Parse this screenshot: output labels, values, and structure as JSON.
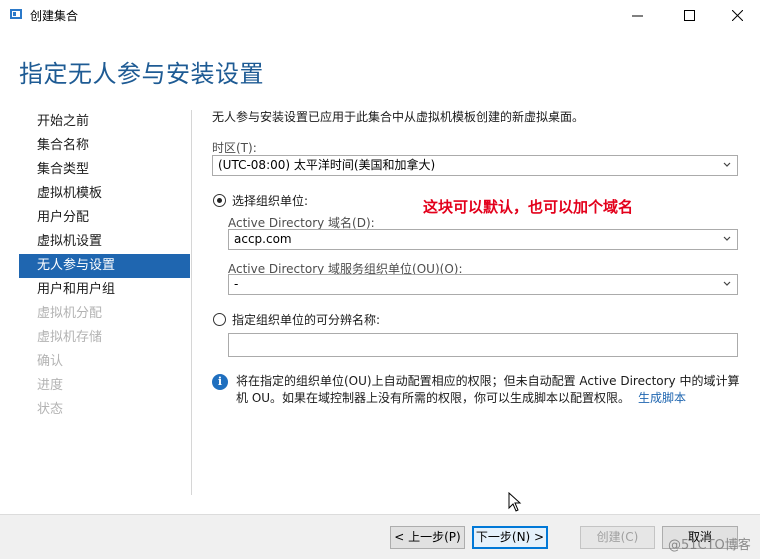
{
  "window": {
    "title": "创建集合"
  },
  "page": {
    "title": "指定无人参与安装设置",
    "description": "无人参与安装设置已应用于此集合中从虚拟机模板创建的新虚拟桌面。"
  },
  "nav": {
    "items": [
      {
        "label": "开始之前",
        "state": "normal"
      },
      {
        "label": "集合名称",
        "state": "normal"
      },
      {
        "label": "集合类型",
        "state": "normal"
      },
      {
        "label": "虚拟机模板",
        "state": "normal"
      },
      {
        "label": "用户分配",
        "state": "normal"
      },
      {
        "label": "虚拟机设置",
        "state": "normal"
      },
      {
        "label": "无人参与设置",
        "state": "active"
      },
      {
        "label": "用户和用户组",
        "state": "normal"
      },
      {
        "label": "虚拟机分配",
        "state": "disabled"
      },
      {
        "label": "虚拟机存储",
        "state": "disabled"
      },
      {
        "label": "确认",
        "state": "disabled"
      },
      {
        "label": "进度",
        "state": "disabled"
      },
      {
        "label": "状态",
        "state": "disabled"
      }
    ]
  },
  "form": {
    "timezone_label": "时区(T):",
    "timezone_value": "(UTC-08:00) 太平洋时间(美国和加拿大)",
    "radio_ou_label": "选择组织单位:",
    "ad_domain_label": "Active Directory 域名(D):",
    "ad_domain_value": "accp.com",
    "ad_ou_label": "Active Directory 域服务组织单位(OU)(O):",
    "ad_ou_value": "-",
    "radio_dn_label": "指定组织单位的可分辨名称:",
    "dn_value": ""
  },
  "annotation": "这块可以默认，也可以加个域名",
  "info": {
    "text": "将在指定的组织单位(OU)上自动配置相应的权限；但未自动配置 Active Directory 中的域计算机 OU。如果在域控制器上没有所需的权限，你可以生成脚本以配置权限。",
    "link": "生成脚本"
  },
  "buttons": {
    "prev": "< 上一步(P)",
    "next": "下一步(N) >",
    "create": "创建(C)",
    "cancel": "取消"
  },
  "watermark": "@51CTO博客",
  "colors": {
    "accent": "#1f66b0",
    "title": "#1e5b94",
    "annotation": "#e3001b"
  }
}
